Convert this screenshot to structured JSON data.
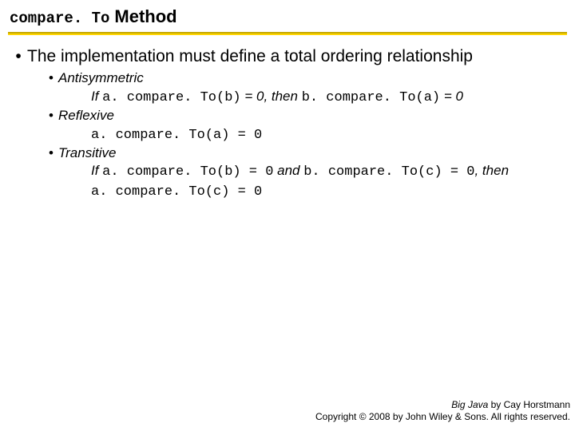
{
  "title": {
    "code": "compare. To",
    "word": "Method"
  },
  "main_bullet": "The implementation must define a total ordering relationship",
  "properties": {
    "antisymmetric": {
      "name": "Antisymmetric",
      "if_text": "If ",
      "code1": "a. compare. To(b)",
      "mid1": " = 0, then ",
      "code2": "b. compare. To(a)",
      "end": " = 0"
    },
    "reflexive": {
      "name": "Reflexive",
      "code": "a. compare. To(a) = 0"
    },
    "transitive": {
      "name": "Transitive",
      "if_text": "If ",
      "code1": "a. compare. To(b) = 0",
      "and_text": " and ",
      "code2": "b. compare. To(c) = 0",
      "then_text": ", then",
      "code3": "a. compare. To(c) = 0"
    }
  },
  "footer": {
    "book_title": "Big Java",
    "author_line": " by Cay Horstmann",
    "copyright": "Copyright © 2008 by John Wiley & Sons.  All rights reserved."
  }
}
